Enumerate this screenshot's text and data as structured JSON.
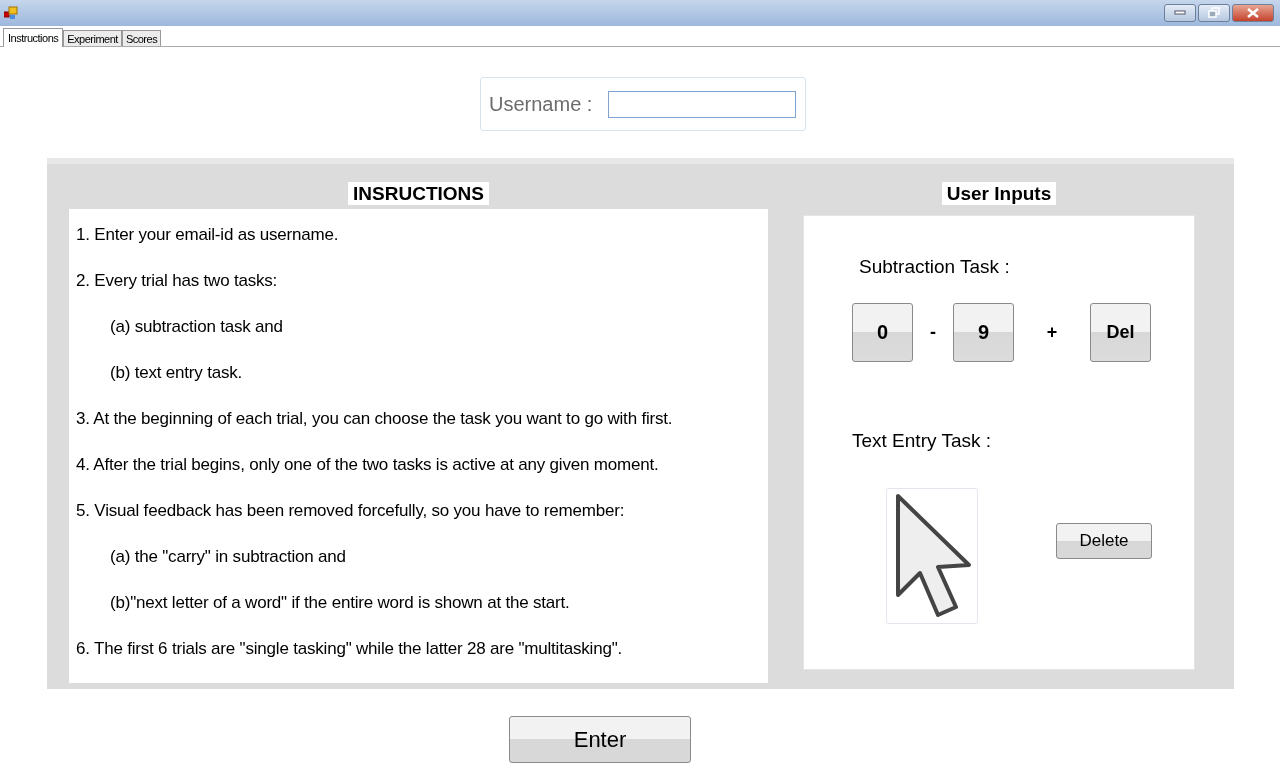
{
  "tabs": [
    {
      "label": "Instructions",
      "selected": true
    },
    {
      "label": "Experiment",
      "selected": false
    },
    {
      "label": "Scores",
      "selected": false
    }
  ],
  "username": {
    "label": "Username :"
  },
  "instructions": {
    "title": "INSRUCTIONS",
    "lines": [
      {
        "kind": "item",
        "text": "1. Enter your email-id as username."
      },
      {
        "kind": "item",
        "text": "2. Every trial has two tasks:"
      },
      {
        "kind": "sub",
        "text": "(a) subtraction task and"
      },
      {
        "kind": "sub",
        "text": "(b) text entry task."
      },
      {
        "kind": "item",
        "text": "3. At the beginning of each trial, you can choose the task you want to go with first."
      },
      {
        "kind": "item",
        "text": "4. After the trial begins, only one of the two tasks is active at any given moment."
      },
      {
        "kind": "item",
        "text": "5. Visual feedback has been removed forcefully, so you have to remember:"
      },
      {
        "kind": "sub",
        "text": "(a) the \"carry\" in subtraction and"
      },
      {
        "kind": "sub",
        "text": "(b)\"next letter of a word\" if the entire word is shown at the start."
      },
      {
        "kind": "item",
        "text": "6. The first 6 trials are \"single tasking\" while the latter 28 are \"multitasking\"."
      }
    ]
  },
  "user_inputs": {
    "title": "User Inputs",
    "subtraction_label": "Subtraction Task :",
    "keys": [
      {
        "kind": "key",
        "label": "0"
      },
      {
        "kind": "sign",
        "label": "-"
      },
      {
        "kind": "key",
        "label": "9"
      },
      {
        "kind": "sign",
        "label": "+"
      },
      {
        "kind": "key",
        "label": "Del"
      }
    ],
    "text_entry_label": "Text Entry Task :",
    "delete_button": "Delete"
  },
  "enter_button": "Enter"
}
